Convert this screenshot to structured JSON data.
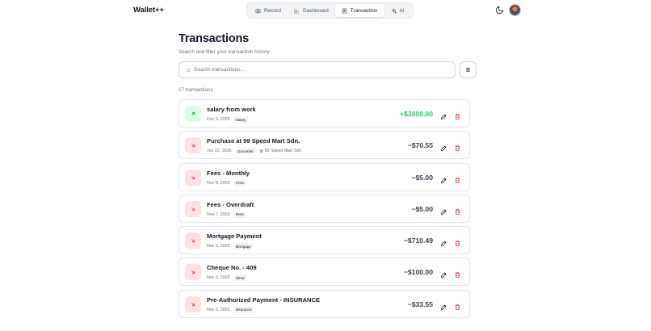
{
  "app": {
    "title": "Wallet++"
  },
  "nav": {
    "items": [
      {
        "label": "Record",
        "icon": "camera-icon",
        "active": false
      },
      {
        "label": "Dashboard",
        "icon": "bar-chart-icon",
        "active": false
      },
      {
        "label": "Transaction",
        "icon": "receipt-icon",
        "active": true
      },
      {
        "label": "AI",
        "icon": "sparkles-icon",
        "active": false
      }
    ]
  },
  "header": {
    "theme_icon": "moon-icon",
    "avatar_icon": "user-avatar"
  },
  "page": {
    "title": "Transactions",
    "subtitle": "Search and filter your transaction history"
  },
  "search": {
    "placeholder": "Search transactions...",
    "value": ""
  },
  "filter": {
    "icon": "sliders-icon"
  },
  "count_label": "17 transactions",
  "colors": {
    "income": "#22c55e",
    "expense": "#ef4444",
    "income_bg": "#dcfce7",
    "expense_bg": "#fee2e2"
  },
  "transactions": [
    {
      "type": "income",
      "name": "salary from work",
      "date": "Dec 6, 2025",
      "category": "Salary",
      "merchant": "",
      "amount": "+$3000.00"
    },
    {
      "type": "expense",
      "name": "Purchase at 99 Speed Mart Sdn.",
      "date": "Jun 22, 2025",
      "category": "Groceries",
      "merchant": "99 Speed Mart Sdn.",
      "amount": "−$70.55"
    },
    {
      "type": "expense",
      "name": "Fees - Monthly",
      "date": "Nov 8, 2003",
      "category": "Fees",
      "merchant": "",
      "amount": "−$5.00"
    },
    {
      "type": "expense",
      "name": "Fees - Overdraft",
      "date": "Nov 7, 2003",
      "category": "Fees",
      "merchant": "",
      "amount": "−$5.00"
    },
    {
      "type": "expense",
      "name": "Mortgage Payment",
      "date": "Nov 6, 2003",
      "category": "Mortgage",
      "merchant": "",
      "amount": "−$710.49"
    },
    {
      "type": "expense",
      "name": "Cheque No. - 409",
      "date": "Nov 3, 2003",
      "category": "Other",
      "merchant": "",
      "amount": "−$100.00"
    },
    {
      "type": "expense",
      "name": "Pre-Authorized Payment - INSURANCE",
      "date": "Nov 3, 2003",
      "category": "Insurance",
      "merchant": "",
      "amount": "−$33.55"
    }
  ]
}
